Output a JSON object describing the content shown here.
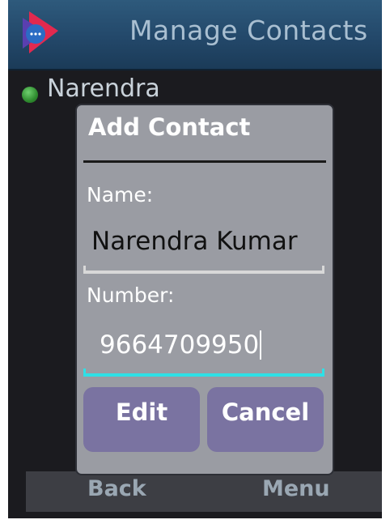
{
  "header": {
    "title": "Manage Contacts",
    "logo_icon": "app-logo-icon"
  },
  "contact_list": {
    "items": [
      {
        "name": "Narendra",
        "status": "online",
        "status_color": "#3aa23a"
      }
    ]
  },
  "dialog": {
    "title": "Add Contact",
    "name_label": "Name:",
    "name_value": "Narendra Kumar",
    "number_label": "Number:",
    "number_value": "9664709950",
    "focused_field": "number",
    "edit_button": "Edit",
    "cancel_button": "Cancel"
  },
  "softkeys": {
    "left": "Back",
    "right": "Menu"
  },
  "colors": {
    "header_bg": "#23486a",
    "title_text": "#a9bfd1",
    "dialog_bg": "#9a9ca3",
    "button_bg": "#7a73a1",
    "focus_underline": "#2ee0e6"
  }
}
